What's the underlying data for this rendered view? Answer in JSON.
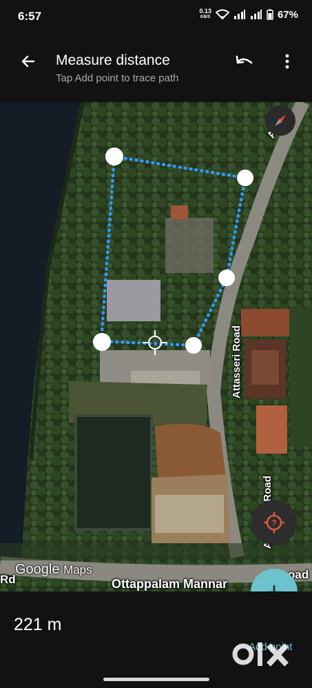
{
  "status_bar": {
    "time": "6:57",
    "net_speed": "0.13",
    "net_unit": "KB/S",
    "battery": "67%"
  },
  "toolbar": {
    "title": "Measure distance",
    "subtitle": "Tap Add point to trace path",
    "back_icon": "arrow-back-icon",
    "undo_icon": "undo-icon",
    "more_icon": "more-vert-icon"
  },
  "map": {
    "attribution_google": "Google",
    "attribution_maps": "Maps",
    "roads": {
      "attass_top": "Attass",
      "attasseri_mid": "Attasseri Road",
      "attasseri_low": "Attasseri Road",
      "ottappalam": "Ottappalam Mannar",
      "ottappalam_end": "oad",
      "left_rd": "Rd"
    },
    "path_color": "#2f9bff"
  },
  "measurement": {
    "distance": "221 m",
    "add_point_label": "Add point"
  },
  "watermark": "OLX",
  "colors": {
    "accent": "#6cc3ce",
    "background": "#121212",
    "location_icon": "#e0563f"
  }
}
